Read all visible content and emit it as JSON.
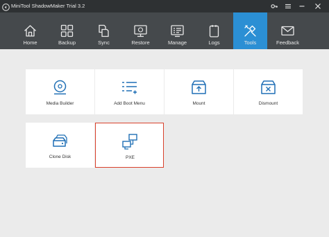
{
  "window": {
    "title": "MiniTool ShadowMaker Trial 3.2"
  },
  "toolbar": {
    "items": [
      {
        "label": "Home",
        "icon": "home-icon"
      },
      {
        "label": "Backup",
        "icon": "backup-icon"
      },
      {
        "label": "Sync",
        "icon": "sync-icon"
      },
      {
        "label": "Restore",
        "icon": "restore-icon"
      },
      {
        "label": "Manage",
        "icon": "manage-icon"
      },
      {
        "label": "Logs",
        "icon": "logs-icon"
      },
      {
        "label": "Tools",
        "icon": "tools-icon",
        "active": true
      },
      {
        "label": "Feedback",
        "icon": "feedback-icon"
      }
    ]
  },
  "tools": {
    "cards": [
      {
        "label": "Media Builder",
        "icon": "media-builder-icon"
      },
      {
        "label": "Add Boot Menu",
        "icon": "boot-menu-icon"
      },
      {
        "label": "Mount",
        "icon": "mount-icon"
      },
      {
        "label": "Dismount",
        "icon": "dismount-icon"
      },
      {
        "label": "Clone Disk",
        "icon": "clone-disk-icon"
      },
      {
        "label": "PXE",
        "icon": "pxe-icon",
        "selected": true
      }
    ]
  },
  "colors": {
    "titlebar": "#2e3133",
    "toolbar": "#45494c",
    "active_tab": "#2b8fd4",
    "selection_border": "#d9402b",
    "background": "#ebebeb"
  }
}
